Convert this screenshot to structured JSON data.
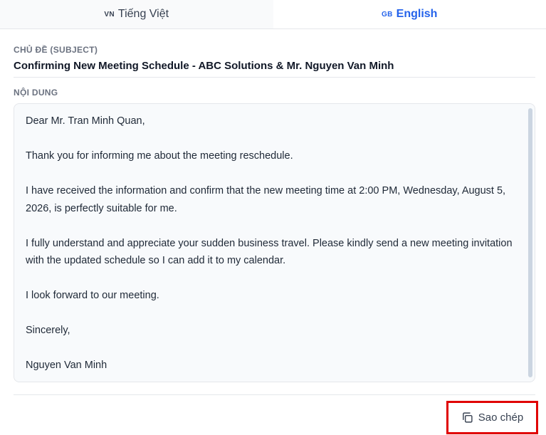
{
  "tabs": [
    {
      "code": "VN",
      "label": "Tiếng Việt",
      "active": false
    },
    {
      "code": "GB",
      "label": "English",
      "active": true
    }
  ],
  "subject": {
    "label": "CHỦ ĐỀ (SUBJECT)",
    "value": "Confirming New Meeting Schedule - ABC Solutions & Mr. Nguyen Van Minh"
  },
  "content": {
    "label": "NỘI DUNG",
    "paragraphs": [
      "Dear Mr. Tran Minh Quan,",
      "Thank you for informing me about the meeting reschedule.",
      "I have received the information and confirm that the new meeting time at 2:00 PM, Wednesday, August 5, 2026, is perfectly suitable for me.",
      "I fully understand and appreciate your sudden business travel. Please kindly send a new meeting invitation with the updated schedule so I can add it to my calendar.",
      "I look forward to our meeting.",
      "Sincerely,",
      "Nguyen Van Minh"
    ]
  },
  "actions": {
    "copy_label": "Sao chép",
    "copy_icon": "copy-icon"
  },
  "colors": {
    "accent": "#2563eb",
    "highlight_border": "#e00000"
  }
}
